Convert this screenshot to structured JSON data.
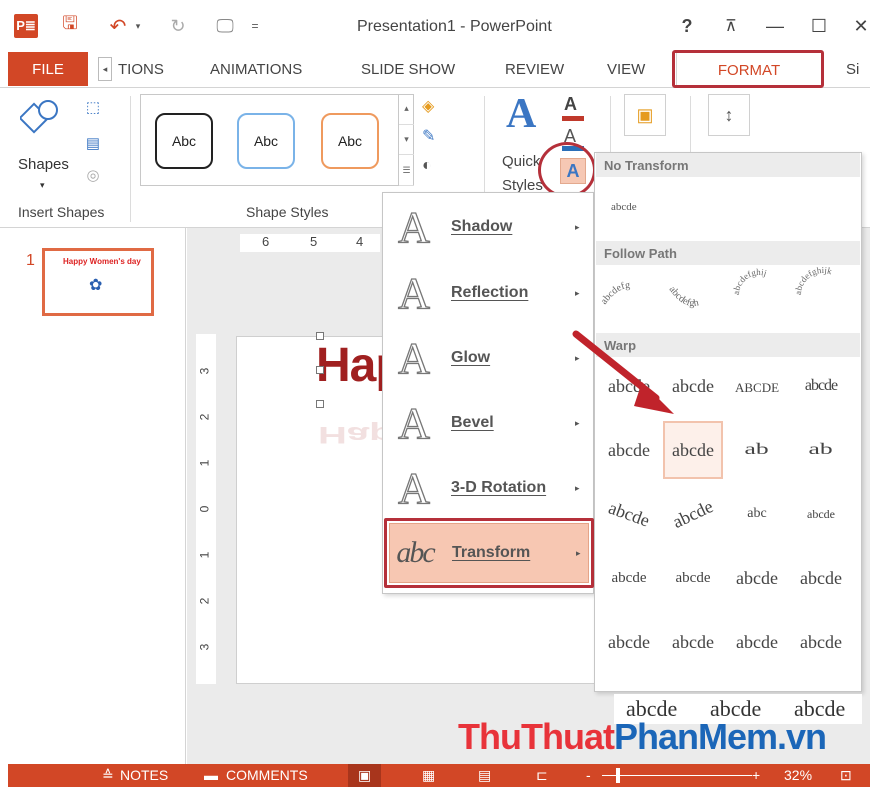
{
  "window": {
    "title": "Presentation1 - PowerPoint",
    "help_glyph": "?",
    "ribbon_display_glyph": "⊼",
    "minimize_glyph": "—",
    "maximize_glyph": "☐",
    "close_glyph": "✕",
    "app_icon_text": "P≣",
    "save_glyph": "🖫",
    "undo_glyph": "↶",
    "undo_dd_glyph": "▾",
    "redo_glyph": "↻",
    "present_glyph": "🖵",
    "qat_dd_glyph": "="
  },
  "tabs": {
    "file": "FILE",
    "scroll_left": "◂",
    "animations_partial": "TIONS",
    "animations": "ANIMATIONS",
    "slideshow": "SLIDE SHOW",
    "review": "REVIEW",
    "view": "VIEW",
    "format": "FORMAT",
    "sign_partial": "Si"
  },
  "ribbon": {
    "shapes_label": "Shapes",
    "insert_shapes_group": "Insert Shapes",
    "shape_styles_group": "Shape Styles",
    "style_swatches": [
      "Abc",
      "Abc",
      "Abc"
    ],
    "quick_styles_label": "Quick Styles",
    "text_effects_glyph": "A",
    "text_fill_glyph": "A",
    "text_outline_glyph": "A",
    "wordart_glyph": "A",
    "dd_glyph": "▾",
    "scroll_up": "▴",
    "scroll_down": "▾",
    "scroll_more": "☰",
    "shape_fill_glyph": "◈",
    "shape_outline_glyph": "✎",
    "shape_effects_glyph": "◐",
    "edit_shape_glyph": "⬚",
    "textbox_glyph": "▤",
    "merge_glyph": "◎",
    "arrange_glyph": "▣",
    "size_glyph": "↕"
  },
  "thumbnails": {
    "slide_number": "1",
    "thumb_title": "Happy Women's day",
    "thumb_flowers_glyph": "✿"
  },
  "slide": {
    "title_partial": "Hap",
    "reflection_partial": "Hap",
    "hruler_labels": [
      "6",
      "5",
      "4"
    ],
    "vruler_labels": [
      "3",
      "2",
      "1",
      "0",
      "1",
      "2",
      "3"
    ]
  },
  "effects_menu": {
    "items": [
      {
        "label": "Shadow",
        "glyph": "A"
      },
      {
        "label": "Reflection",
        "glyph": "A"
      },
      {
        "label": "Glow",
        "glyph": "A"
      },
      {
        "label": "Bevel",
        "glyph": "A"
      },
      {
        "label": "3-D Rotation",
        "glyph": "A"
      },
      {
        "label": "Transform",
        "glyph": "abc"
      }
    ],
    "arrow_glyph": "▸"
  },
  "transform_gallery": {
    "no_transform_header": "No Transform",
    "no_transform_sample": "abcde",
    "follow_path_header": "Follow Path",
    "warp_header": "Warp",
    "follow_path_samples": [
      "abcdefg",
      "abcdefgh",
      "abcdefghij",
      "abcdefghijk"
    ],
    "warp_samples": [
      "abcde",
      "abcde",
      "abcde",
      "abcde",
      "abcde",
      "abcde",
      "ab",
      "ab",
      "abcde",
      "abcde",
      "abc",
      "abcde",
      "abcde",
      "abcde",
      "abcde",
      "abcde",
      "abcde",
      "abcde",
      "abcde",
      "abcde"
    ],
    "extra_row": [
      "abcde",
      "abcde",
      "abcde"
    ]
  },
  "watermark": {
    "part1": "ThuThuat",
    "part2": "PhanMem",
    "part3": ".vn",
    "color1": "#e8333a",
    "color2": "#1b66b8"
  },
  "statusbar": {
    "notes": "NOTES",
    "comments": "COMMENTS",
    "notes_glyph": "≙",
    "comments_glyph": "▬",
    "normal_view_glyph": "▣",
    "sorter_glyph": "▦",
    "reading_glyph": "▤",
    "slideshow_glyph": "⊏",
    "zoom_minus": "-",
    "zoom_plus": "+",
    "zoom": "32%",
    "fit_glyph": "⊡"
  },
  "colors": {
    "accent": "#d24726",
    "highlight": "#b5303a",
    "selection_fill": "#f7c7b2"
  }
}
